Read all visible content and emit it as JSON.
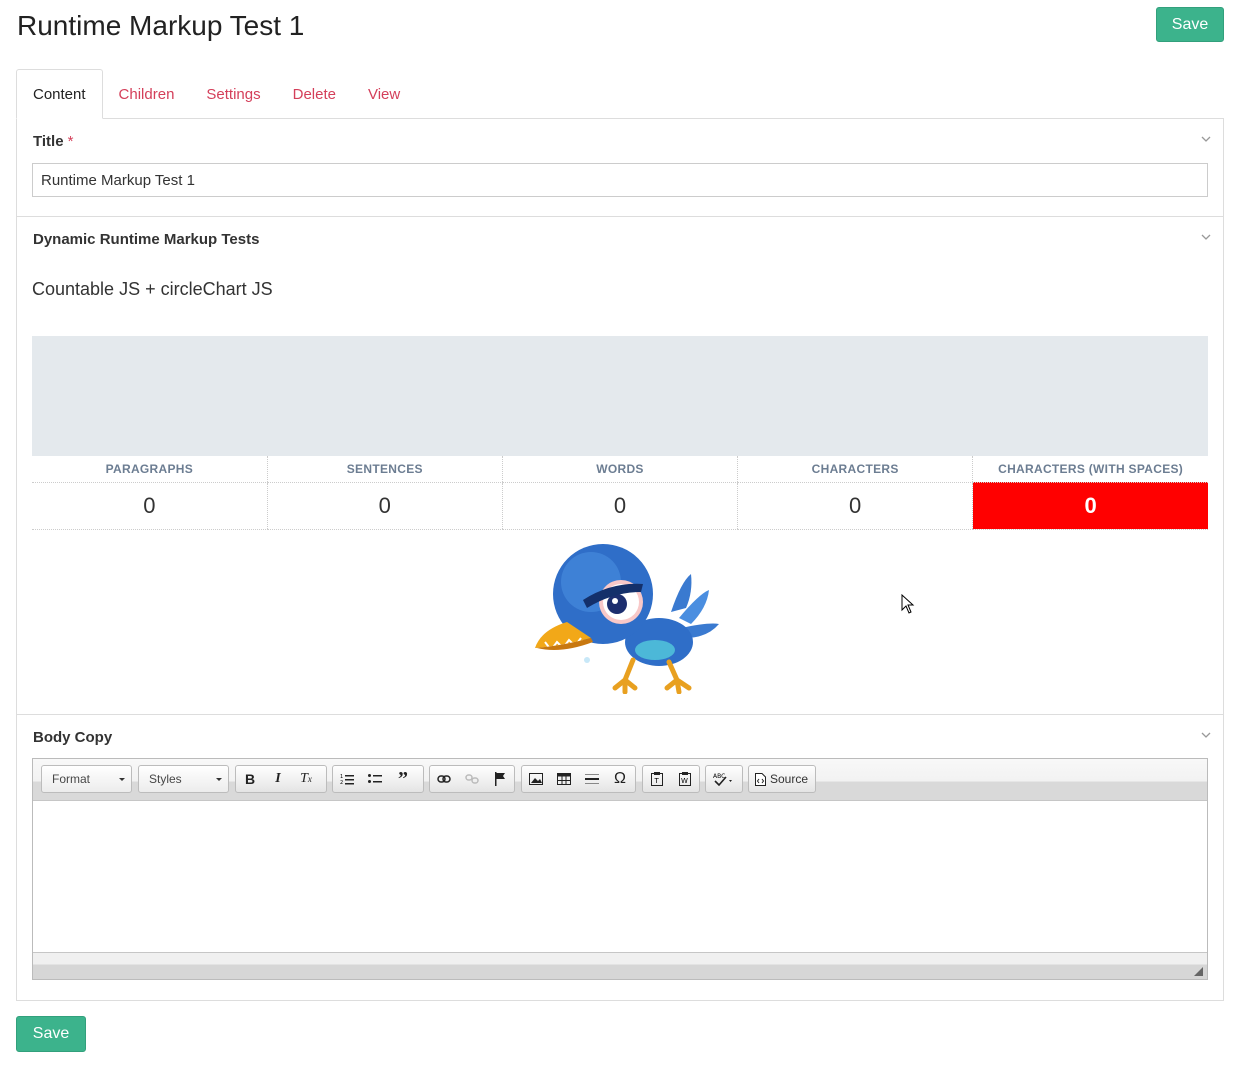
{
  "page": {
    "title": "Runtime Markup Test 1",
    "save_label": "Save"
  },
  "tabs": [
    {
      "label": "Content",
      "active": true
    },
    {
      "label": "Children"
    },
    {
      "label": "Settings"
    },
    {
      "label": "Delete"
    },
    {
      "label": "View"
    }
  ],
  "title_panel": {
    "label": "Title",
    "required_mark": "*",
    "value": "Runtime Markup Test 1"
  },
  "markup_panel": {
    "label": "Dynamic Runtime Markup Tests",
    "subtitle": "Countable JS + circleChart JS",
    "stats": {
      "headers": [
        "PARAGRAPHS",
        "SENTENCES",
        "WORDS",
        "CHARACTERS",
        "CHARACTERS (WITH SPACES)"
      ],
      "values": [
        "0",
        "0",
        "0",
        "0",
        "0"
      ],
      "alert_color": "#ff0000"
    }
  },
  "body_panel": {
    "label": "Body Copy",
    "toolbar": {
      "format_label": "Format",
      "styles_label": "Styles",
      "source_label": "Source",
      "icons": [
        "bold-icon",
        "italic-icon",
        "remove-format-icon",
        "numbered-list-icon",
        "bulleted-list-icon",
        "blockquote-icon",
        "link-icon",
        "unlink-icon",
        "anchor-icon",
        "image-icon",
        "table-icon",
        "horizontal-line-icon",
        "special-char-icon",
        "paste-text-icon",
        "paste-word-icon",
        "spellcheck-icon",
        "source-icon"
      ]
    }
  },
  "colors": {
    "accent": "#3cb38c",
    "tab_link": "#d43f5a",
    "chart_placeholder": "#e4e9ed"
  }
}
